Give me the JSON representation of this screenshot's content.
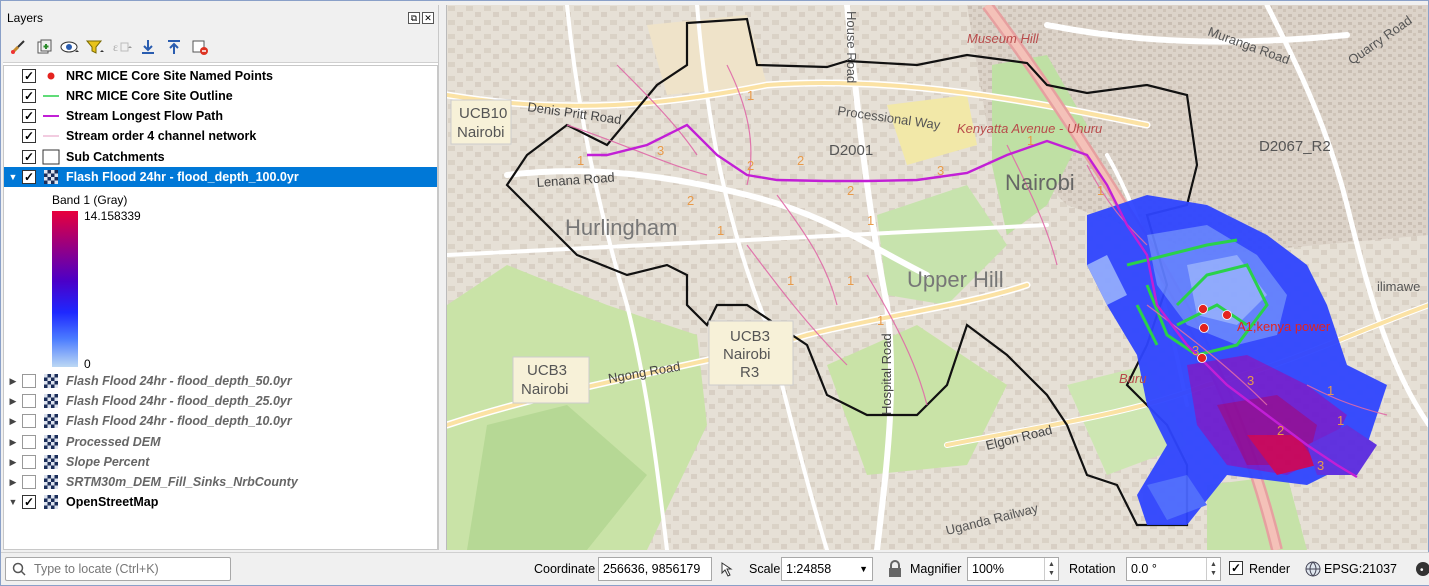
{
  "panel": {
    "title": "Layers",
    "toolbar_icons": [
      "style-brush-icon",
      "add-group-icon",
      "visibility-eye-icon",
      "filter-funnel-icon",
      "expression-filter-icon",
      "expand-all-icon",
      "collapse-all-icon",
      "remove-layer-icon"
    ]
  },
  "layers": [
    {
      "label": "NRC MICE Core Site Named Points",
      "checked": true,
      "symbol": "red-point",
      "selected": false,
      "expander": ""
    },
    {
      "label": "NRC MICE Core Site Outline",
      "checked": true,
      "symbol": "green-line",
      "selected": false,
      "expander": ""
    },
    {
      "label": "Stream Longest Flow Path",
      "checked": true,
      "symbol": "magenta-line",
      "selected": false,
      "expander": ""
    },
    {
      "label": "Stream order 4 channel network",
      "checked": true,
      "symbol": "pink-line",
      "selected": false,
      "expander": ""
    },
    {
      "label": "Sub Catchments",
      "checked": true,
      "symbol": "hollow-polygon",
      "selected": false,
      "expander": ""
    },
    {
      "label": "Flash Flood 24hr - flood_depth_100.0yr",
      "checked": true,
      "symbol": "raster",
      "selected": true,
      "expander": "▼"
    },
    {
      "label": "Flash Flood 24hr - flood_depth_50.0yr",
      "checked": false,
      "symbol": "raster",
      "selected": false,
      "expander": "▶"
    },
    {
      "label": "Flash Flood 24hr - flood_depth_25.0yr",
      "checked": false,
      "symbol": "raster",
      "selected": false,
      "expander": "▶"
    },
    {
      "label": "Flash Flood 24hr - flood_depth_10.0yr",
      "checked": false,
      "symbol": "raster",
      "selected": false,
      "expander": "▶"
    },
    {
      "label": "Processed DEM",
      "checked": false,
      "symbol": "raster",
      "selected": false,
      "expander": "▶"
    },
    {
      "label": "Slope Percent",
      "checked": false,
      "symbol": "raster",
      "selected": false,
      "expander": "▶"
    },
    {
      "label": "SRTM30m_DEM_Fill_Sinks_NrbCounty",
      "checked": false,
      "symbol": "raster",
      "selected": false,
      "expander": "▶"
    },
    {
      "label": "OpenStreetMap",
      "checked": true,
      "symbol": "raster",
      "selected": false,
      "expander": "▼"
    }
  ],
  "legend": {
    "band_title": "Band 1 (Gray)",
    "max": "14.158339",
    "min": "0"
  },
  "map": {
    "labels": {
      "museum_hill": "Museum Hill",
      "muranga": "Muranga Road",
      "quarry": "Quarry Road",
      "ucb10_a": "UCB10",
      "ucb10_b": "Nairobi",
      "denis": "Denis Pritt Road",
      "processional": "Processional Way",
      "kenyatta": "Kenyatta Avenue - Uhuru",
      "d2001": "D2001",
      "d2067": "D2067_R2",
      "lenana": "Lenana Road",
      "nairobi": "Nairobi",
      "hurlingham": "Hurlingham",
      "upper_hill": "Upper Hill",
      "ucb3_a": "UCB3",
      "ucb3_b": "Nairobi",
      "ucb3_c": "R3",
      "ucb3l_a": "UCB3",
      "ucb3l_b": "Nairobi",
      "ngong": "Ngong Road",
      "hospital": "Hospital Road",
      "elgon": "Elgon Road",
      "a1": "A1;kenya power",
      "buru": "Buru",
      "mawe": "ilimawe",
      "railway": "Uganda Railway",
      "hosp_top": "House Road"
    }
  },
  "status": {
    "locator_placeholder": "Type to locate (Ctrl+K)",
    "coordinate_label": "Coordinate",
    "coordinate_value": "256636, 9856179",
    "scale_label": "Scale",
    "scale_value": "1:24858",
    "magnifier_label": "Magnifier",
    "magnifier_value": "100%",
    "rotation_label": "Rotation",
    "rotation_value": "0.0 °",
    "render_label": "Render",
    "render_checked": true,
    "crs": "EPSG:21037"
  }
}
